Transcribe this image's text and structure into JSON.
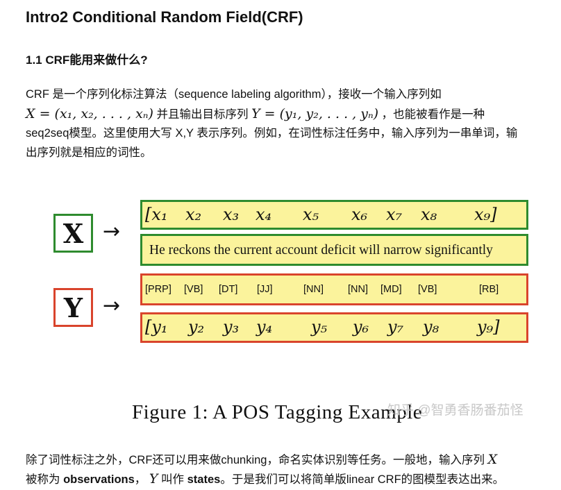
{
  "heading": "Intro2 Conditional Random Field(CRF)",
  "subheading": "1.1 CRF能用来做什么?",
  "para1": {
    "l1": "CRF 是一个序列化标注算法（sequence labeling algorithm），接收一个输入序列如",
    "l2_math_x": "X = (x₁, x₂, . . . , xₙ)",
    "l2_mid": "并且输出目标序列",
    "l2_math_y": "Y = (y₁, y₂, . . . , yₙ)",
    "l2_end": "，也能被看作是一种",
    "l3": "seq2seq模型。这里使用大写 X,Y 表示序列。例如，在词性标注任务中，输入序列为一串单词，输",
    "l4": "出序列就是相应的词性。"
  },
  "figure": {
    "x_label": "X",
    "y_label": "Y",
    "arrow": "→",
    "x_tokens": [
      "[x₁",
      "x₂",
      "x₃",
      "x₄",
      "x₅",
      "x₆",
      "x₇",
      "x₈",
      "x₉]"
    ],
    "sentence": "He reckons the current account deficit will narrow significantly",
    "tags": [
      "[PRP]",
      "[VB]",
      "[DT]",
      "[JJ]",
      "[NN]",
      "[NN]",
      "[MD]",
      "[VB]",
      "[RB]"
    ],
    "y_tokens": [
      "[y₁",
      "y₂",
      "y₃",
      "y₄",
      "y₅",
      "y₆",
      "y₇",
      "y₈",
      "y₉]"
    ],
    "caption": "Figure 1:  A POS Tagging Example",
    "watermark": "知乎 @智勇香肠番茄怪",
    "colors": {
      "green": "#2e8b2e",
      "red": "#d9442c",
      "fill": "#fbf39c"
    }
  },
  "para2": {
    "l1_text": "除了词性标注之外，CRF还可以用来做chunking，命名实体识别等任务。一般地，输入序列",
    "l1_math": "X",
    "l2_start": "被称为",
    "l2_bold1": "observations",
    "l2_sep": "，",
    "l2_math": "Y",
    "l2_mid": "叫作",
    "l2_bold2": "states",
    "l2_end": "。于是我们可以将简单版linear CRF的图模型表达出来。"
  }
}
